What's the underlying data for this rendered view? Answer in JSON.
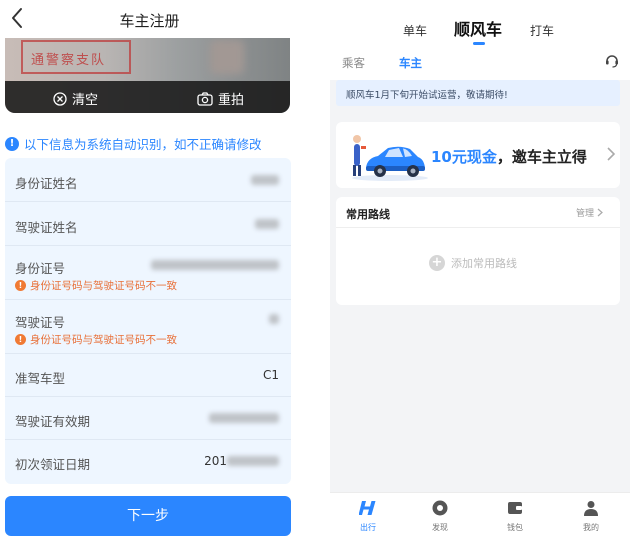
{
  "left": {
    "nav": {
      "title": "车主注册"
    },
    "photo": {
      "stamp_text": "通警察支队",
      "clear_label": "清空",
      "retake_label": "重拍"
    },
    "hint": "以下信息为系统自动识别，如不正确请修改",
    "rows": [
      {
        "label": "身份证姓名",
        "value": ""
      },
      {
        "label": "驾驶证姓名",
        "value": ""
      },
      {
        "label": "身份证号",
        "value": "",
        "error": "身份证号码与驾驶证号码不一致"
      },
      {
        "label": "驾驶证号",
        "value": "",
        "error": "身份证号码与驾驶证号码不一致"
      },
      {
        "label": "准驾车型",
        "value": "C1"
      },
      {
        "label": "驾驶证有效期",
        "value": ""
      },
      {
        "label": "初次领证日期",
        "value": "201"
      }
    ],
    "next_label": "下一步"
  },
  "right": {
    "tabs": [
      {
        "label": "单车"
      },
      {
        "label": "顺风车"
      },
      {
        "label": "打车"
      }
    ],
    "subtabs": [
      {
        "label": "乘客"
      },
      {
        "label": "车主"
      }
    ],
    "notice": "顺风车1月下旬开始试运营，敬请期待!",
    "promo": {
      "amount": "10元现金",
      "rest": "，邀车主立得"
    },
    "routes": {
      "title": "常用路线",
      "manage": "管理",
      "add": "添加常用路线"
    },
    "tabbar": [
      {
        "label": "出行",
        "icon": "ride-icon"
      },
      {
        "label": "发现",
        "icon": "discover-icon"
      },
      {
        "label": "钱包",
        "icon": "wallet-icon"
      },
      {
        "label": "我的",
        "icon": "profile-icon"
      }
    ]
  },
  "colors": {
    "accent": "#2b86ff",
    "error": "#f07a34",
    "form_bg": "#eef6ff"
  }
}
